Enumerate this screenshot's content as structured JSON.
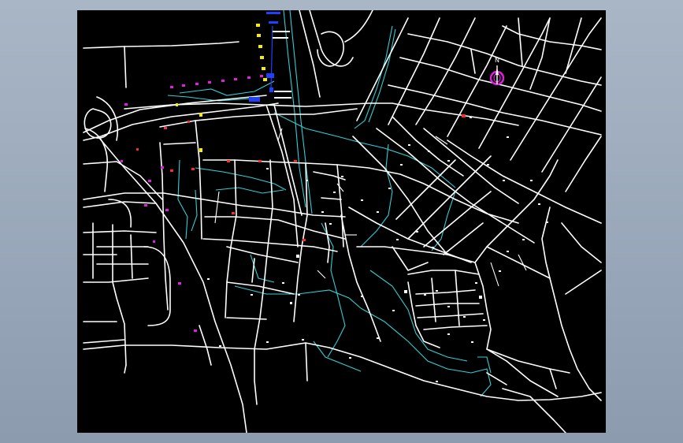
{
  "map": {
    "background": "#000000",
    "road_color": "#ffffff",
    "water_color": "#2fd0d6",
    "marker_colors": {
      "magenta": "#e020e0",
      "red": "#ff2a2a",
      "yellow": "#f5f000",
      "blue": "#2040ff"
    },
    "north_arrow": {
      "label": "N",
      "color": "#e020e0",
      "icon": "north-arrow-icon"
    }
  }
}
